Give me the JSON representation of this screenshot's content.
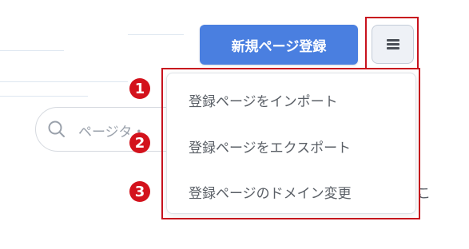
{
  "header": {
    "register_button_label": "新規ページ登録",
    "menu_button_icon": "hamburger-icon"
  },
  "search": {
    "placeholder": "ページタ・"
  },
  "dropdown": {
    "items": [
      {
        "label": "登録ページをインポート",
        "badge": "1"
      },
      {
        "label": "登録ページをエクスポート",
        "badge": "2"
      },
      {
        "label": "登録ページのドメイン変更",
        "badge": "3"
      }
    ]
  },
  "fragments": {
    "right_edge_char": "こ"
  },
  "colors": {
    "primary": "#4a7fe0",
    "highlight": "#c8131e",
    "badge": "#d3121c"
  }
}
